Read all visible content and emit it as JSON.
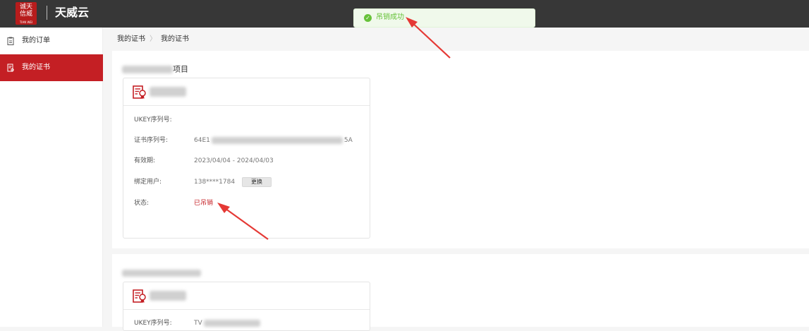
{
  "header": {
    "logo_text": "诚天信威",
    "logo_sub": "TIAN WEI",
    "brand": "天威云"
  },
  "toast": {
    "message": "吊销成功",
    "icon": "check-circle-icon",
    "color": "#67c23a"
  },
  "sidebar": {
    "items": [
      {
        "label": "我的订单",
        "icon": "clipboard-icon",
        "active": false
      },
      {
        "label": "我的证书",
        "icon": "certificate-doc-icon",
        "active": true
      }
    ]
  },
  "breadcrumb": {
    "root": "我的证书",
    "current": "我的证书"
  },
  "projects": [
    {
      "title_suffix": "项目",
      "card": {
        "fields": [
          {
            "label": "UKEY序列号:",
            "value": ""
          },
          {
            "label": "证书序列号:",
            "value_start": "64E1",
            "value_end": "5A"
          },
          {
            "label": "有效期:",
            "value": "2023/04/04 - 2024/04/03"
          },
          {
            "label": "绑定用户:",
            "value": "138****1784",
            "action": "更换"
          },
          {
            "label": "状态:",
            "value": "已吊销"
          }
        ]
      }
    },
    {
      "title_suffix": "",
      "card": {
        "fields": [
          {
            "label": "UKEY序列号:",
            "value_start": "TV"
          }
        ]
      }
    }
  ],
  "colors": {
    "brand_red": "#c41f24",
    "header_bg": "#373737",
    "success": "#67c23a"
  }
}
